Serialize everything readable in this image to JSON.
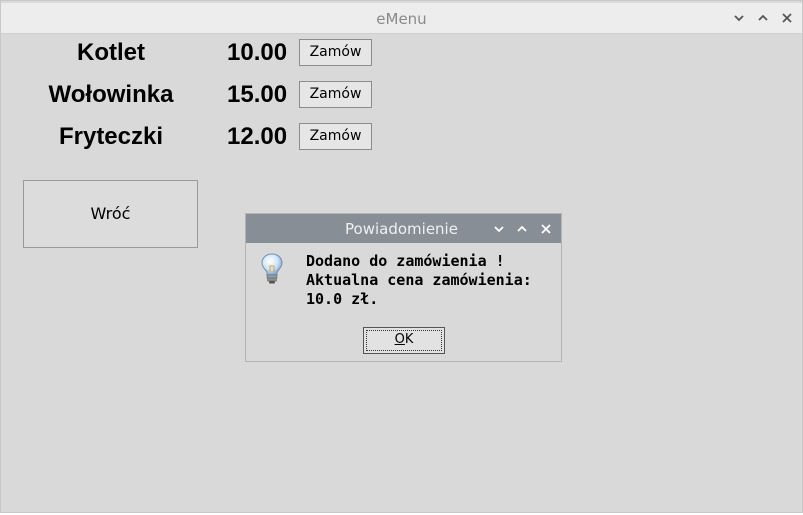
{
  "window": {
    "title": "eMenu"
  },
  "menu": {
    "items": [
      {
        "name": "Kotlet",
        "price": "10.00",
        "button": "Zamów"
      },
      {
        "name": "Wołowinka",
        "price": "15.00",
        "button": "Zamów"
      },
      {
        "name": "Fryteczki",
        "price": "12.00",
        "button": "Zamów"
      }
    ],
    "back_label": "Wróć"
  },
  "dialog": {
    "title": "Powiadomienie",
    "message_lines": [
      "Dodano do zamówienia !",
      "Aktualna cena zamówienia:",
      "10.0 zł."
    ],
    "ok_first": "O",
    "ok_rest": "K",
    "icon": "lightbulb-icon"
  },
  "colors": {
    "accent": "#f08c44",
    "dialog_titlebar": "#878e96",
    "background": "#d9d9d9"
  }
}
